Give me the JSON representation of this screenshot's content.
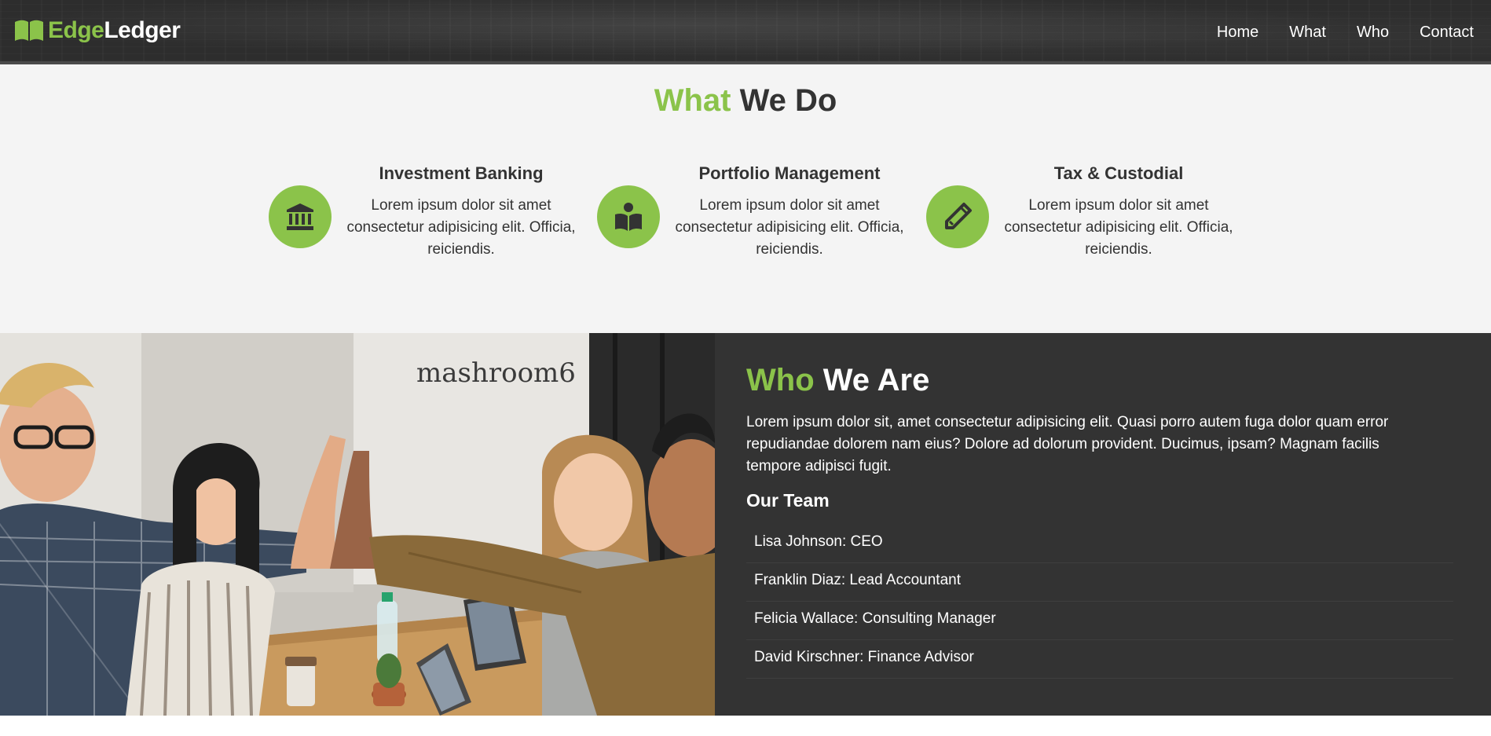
{
  "brand": {
    "name_part1": "Edge",
    "name_part2": "Ledger",
    "icon": "book-icon",
    "accent_color": "#8bc34a"
  },
  "nav": {
    "items": [
      {
        "label": "Home"
      },
      {
        "label": "What"
      },
      {
        "label": "Who"
      },
      {
        "label": "Contact"
      }
    ]
  },
  "what": {
    "title_accent": "What",
    "title_rest": "We Do",
    "services": [
      {
        "icon": "bank-icon",
        "title": "Investment Banking",
        "text": "Lorem ipsum dolor sit amet consectetur adipisicing elit. Officia, reiciendis."
      },
      {
        "icon": "book-reader-icon",
        "title": "Portfolio Management",
        "text": "Lorem ipsum dolor sit amet consectetur adipisicing elit. Officia, reiciendis."
      },
      {
        "icon": "pencil-icon",
        "title": "Tax & Custodial",
        "text": "Lorem ipsum dolor sit amet consectetur adipisicing elit. Officia, reiciendis."
      }
    ]
  },
  "who": {
    "title_accent": "Who",
    "title_rest": "We Are",
    "text": "Lorem ipsum dolor sit, amet consectetur adipisicing elit. Quasi porro autem fuga dolor quam error repudiandae dolorem nam eius? Dolore ad dolorum provident. Ducimus, ipsam? Magnam facilis tempore adipisci fugit.",
    "team_heading": "Our Team",
    "team": [
      {
        "label": "Lisa Johnson: CEO"
      },
      {
        "label": "Franklin Diaz: Lead Accountant"
      },
      {
        "label": "Felicia Wallace: Consulting Manager"
      },
      {
        "label": "David Kirschner: Finance Advisor"
      }
    ],
    "photo_sign_text": "mashroom6"
  },
  "colors": {
    "accent": "#8bc34a",
    "dark": "#333333",
    "light_bg": "#f4f4f4"
  }
}
